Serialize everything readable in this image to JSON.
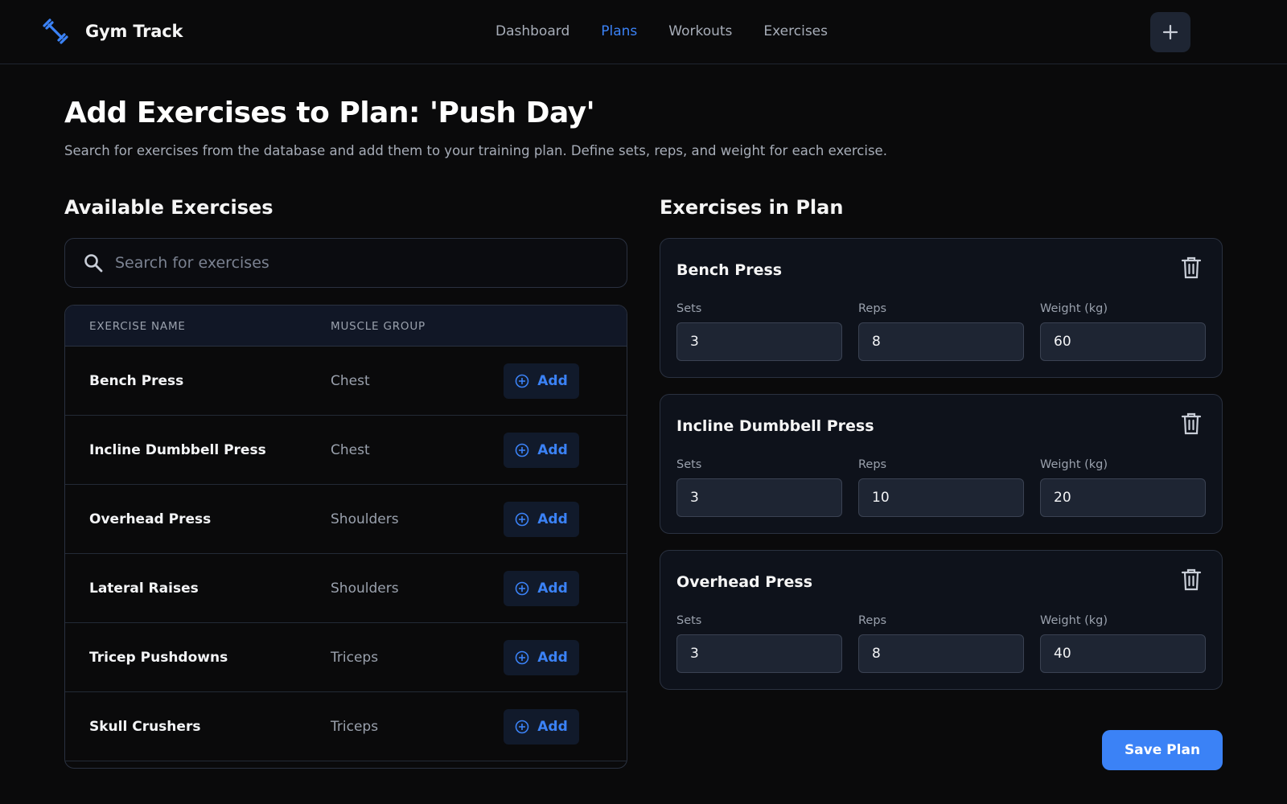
{
  "app": {
    "name": "Gym Track",
    "logo_icon": "dumbbell-icon",
    "accent": "#3b82f6"
  },
  "nav": {
    "items": [
      {
        "label": "Dashboard",
        "active": false
      },
      {
        "label": "Plans",
        "active": true
      },
      {
        "label": "Workouts",
        "active": false
      },
      {
        "label": "Exercises",
        "active": false
      }
    ],
    "add_icon": "plus-icon"
  },
  "page": {
    "title": "Add Exercises to Plan: 'Push Day'",
    "subtitle": "Search for exercises from the database and add them to your training plan. Define sets, reps, and weight for each exercise."
  },
  "available": {
    "heading": "Available Exercises",
    "search_placeholder": "Search for exercises",
    "search_value": "",
    "columns": [
      "EXERCISE NAME",
      "MUSCLE GROUP"
    ],
    "add_label": "Add",
    "rows": [
      {
        "name": "Bench Press",
        "group": "Chest"
      },
      {
        "name": "Incline Dumbbell Press",
        "group": "Chest"
      },
      {
        "name": "Overhead Press",
        "group": "Shoulders"
      },
      {
        "name": "Lateral Raises",
        "group": "Shoulders"
      },
      {
        "name": "Tricep Pushdowns",
        "group": "Triceps"
      },
      {
        "name": "Skull Crushers",
        "group": "Triceps"
      }
    ]
  },
  "plan": {
    "heading": "Exercises in Plan",
    "labels": {
      "sets": "Sets",
      "reps": "Reps",
      "weight": "Weight (kg)"
    },
    "items": [
      {
        "name": "Bench Press",
        "sets": "3",
        "reps": "8",
        "weight": "60"
      },
      {
        "name": "Incline Dumbbell Press",
        "sets": "3",
        "reps": "10",
        "weight": "20"
      },
      {
        "name": "Overhead Press",
        "sets": "3",
        "reps": "8",
        "weight": "40"
      }
    ],
    "save_label": "Save Plan"
  }
}
